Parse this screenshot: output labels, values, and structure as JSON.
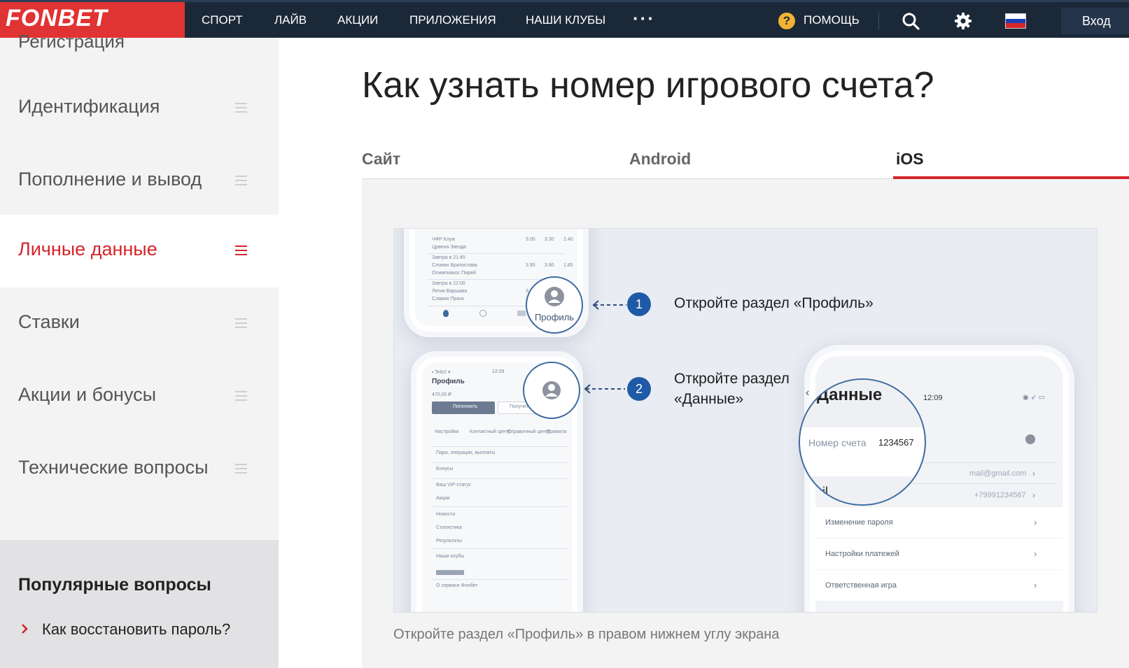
{
  "header": {
    "logo": "FONBET",
    "nav": [
      "СПОРТ",
      "ЛАЙВ",
      "АКЦИИ",
      "ПРИЛОЖЕНИЯ",
      "НАШИ КЛУБЫ"
    ],
    "more": "···",
    "help": "ПОМОЩЬ",
    "help_icon": "?",
    "login": "Вход",
    "icons": [
      "search-icon",
      "gear-icon",
      "russia-flag-icon"
    ]
  },
  "sidebar": {
    "partial_top": "Регистрация",
    "items": [
      {
        "label": "Идентификация"
      },
      {
        "label": "Пополнение и вывод"
      },
      {
        "label": "Личные данные",
        "active": true
      },
      {
        "label": "Ставки"
      },
      {
        "label": "Акции и бонусы"
      },
      {
        "label": "Технические вопросы"
      }
    ],
    "popular_title": "Популярные вопросы",
    "popular_links": [
      "Как восстановить пароль?"
    ]
  },
  "main": {
    "title": "Как узнать номер игрового счета?",
    "tabs": [
      {
        "label": "Сайт"
      },
      {
        "label": "Android"
      },
      {
        "label": "iOS",
        "active": true
      }
    ],
    "caption": "Откройте раздел «Профиль» в правом нижнем углу экрана"
  },
  "illustration": {
    "step1_num": "1",
    "step1_text": "Откройте раздел «Профиль»",
    "step2_num": "2",
    "step2_text_line1": "Откройте раздел",
    "step2_text_line2": "«Данные»",
    "profile_label": "Профиль",
    "data_title": "Данные",
    "account_label": "Номер счета",
    "account_number": "1234567",
    "time": "12:09",
    "email_partial": "ail",
    "email_value": "mail@gmail.com",
    "phone_value": "+79991234567",
    "menu_change_password": "Изменение пароля",
    "menu_payment_settings": "Настройки платежей",
    "menu_responsible_game": "Ответственная игра",
    "phone1_rows": [
      {
        "line1": "ЧФР Клуж",
        "line2": "Црвена Звезда",
        "odds": [
          "3.00",
          "3.30",
          "2.40"
        ]
      },
      {
        "line1": "Слован Братислава",
        "line2": "Олимпиакос Пирей",
        "odds": [
          "3.95",
          "3.80",
          "1.85"
        ]
      },
      {
        "line1": "Легия Варшава",
        "line2": "Славия Прага",
        "odds": [
          "3.35"
        ]
      }
    ],
    "phone1_times": [
      "Завтра в 21:45",
      "Завтра в 22:00"
    ],
    "phone2_title": "Профиль",
    "phone2_balance": "470,00 ₽",
    "phone2_btn1": "Пополнить",
    "phone2_btn2": "Получить выигрыш",
    "phone2_tiles": [
      "Настройки",
      "Контактный центр",
      "Справочный центр",
      "Правила"
    ],
    "phone2_rows": [
      "Пари, операции, выплаты",
      "Бонусы",
      "Ваш VIP-статус",
      "Акции",
      "Новости",
      "Статистика",
      "Результаты",
      "Наши клубы",
      "О сервисе Фонбет"
    ]
  },
  "colors": {
    "brand_red": "#e03333",
    "header_bg": "#1b2838",
    "accent_red": "#d3262b",
    "step_blue": "#1f5aa6"
  }
}
